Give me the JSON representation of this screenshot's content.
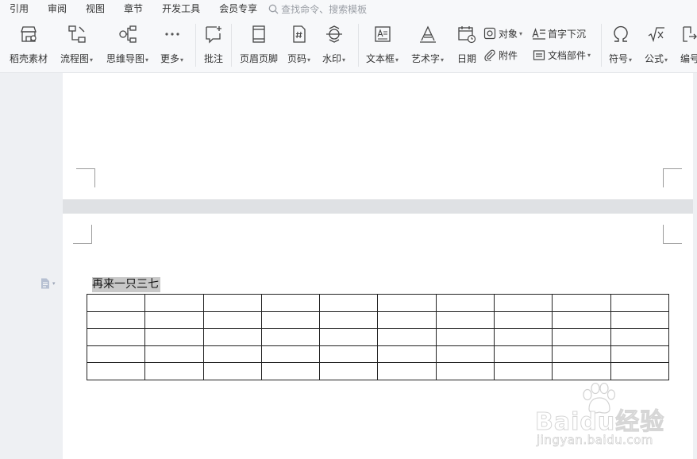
{
  "menu": {
    "items": [
      "引用",
      "审阅",
      "视图",
      "章节",
      "开发工具",
      "会员专享"
    ],
    "search_placeholder": "查找命令、搜索模板"
  },
  "ribbon": {
    "daoke": "稻壳素材",
    "flowchart": "流程图",
    "mindmap": "思维导图",
    "more": "更多",
    "comment": "批注",
    "header_footer": "页眉页脚",
    "page_number": "页码",
    "watermark": "水印",
    "textbox": "文本框",
    "wordart": "艺术字",
    "date": "日期",
    "object": "对象",
    "attachment": "附件",
    "dropcap": "首字下沉",
    "doc_parts": "文档部件",
    "symbol": "符号",
    "formula": "公式",
    "numbering": "编号"
  },
  "document": {
    "paragraph_text": "再来一只三七",
    "table": {
      "rows": 5,
      "cols": 10
    }
  },
  "watermark": {
    "brand": "Baidu经验",
    "url": "jingyan.baidu.com"
  }
}
